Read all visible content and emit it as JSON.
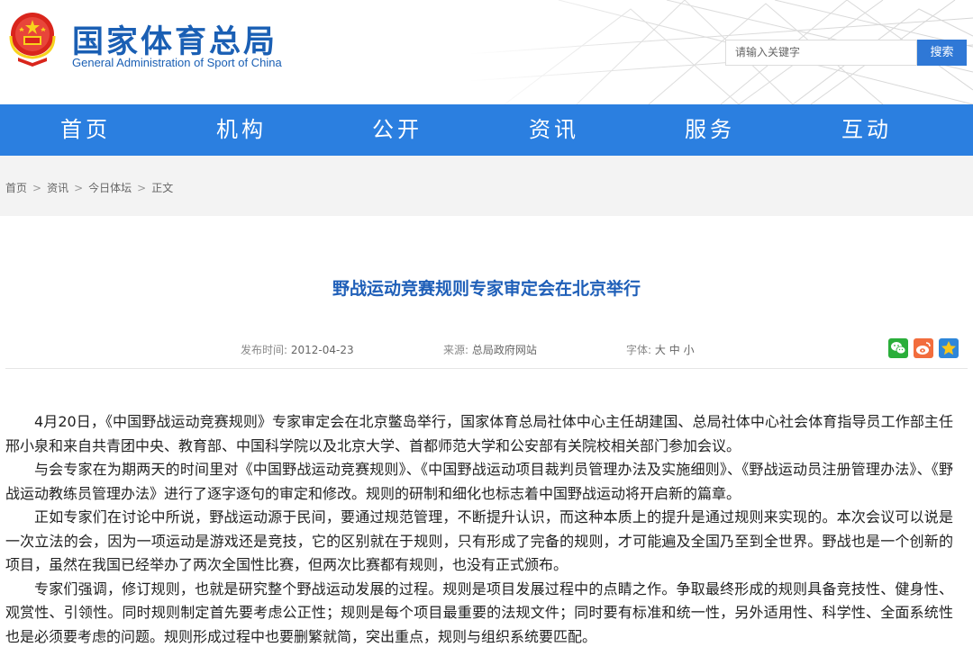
{
  "header": {
    "title": "国家体育总局",
    "subtitle": "General Administration of Sport of China",
    "search_placeholder": "请输入关键字",
    "search_button": "搜索"
  },
  "nav": {
    "items": [
      {
        "label": "首页"
      },
      {
        "label": "机构"
      },
      {
        "label": "公开"
      },
      {
        "label": "资讯"
      },
      {
        "label": "服务"
      },
      {
        "label": "互动"
      }
    ]
  },
  "breadcrumb": {
    "items": [
      "首页",
      "资讯",
      "今日体坛",
      "正文"
    ],
    "separator": ">"
  },
  "article": {
    "title": "野战运动竞赛规则专家审定会在北京举行",
    "date_label": "发布时间:",
    "date_value": "2012-04-23",
    "source_label": "来源:",
    "source_value": "总局政府网站",
    "font_label": "字体:",
    "font_large": "大",
    "font_medium": "中",
    "font_small": "小",
    "share_icons": [
      "wechat-icon",
      "weibo-icon",
      "favorite-icon"
    ],
    "paragraphs": [
      "4月20日，《中国野战运动竞赛规则》专家审定会在北京鳖岛举行，国家体育总局社体中心主任胡建国、总局社体中心社会体育指导员工作部主任邢小泉和来自共青团中央、教育部、中国科学院以及北京大学、首都师范大学和公安部有关院校相关部门参加会议。",
      "与会专家在为期两天的时间里对《中国野战运动竞赛规则》、《中国野战运动项目裁判员管理办法及实施细则》、《野战运动员注册管理办法》、《野战运动教练员管理办法》进行了逐字逐句的审定和修改。规则的研制和细化也标志着中国野战运动将开启新的篇章。",
      "正如专家们在讨论中所说，野战运动源于民间，要通过规范管理，不断提升认识，而这种本质上的提升是通过规则来实现的。本次会议可以说是一次立法的会，因为一项运动是游戏还是竞技，它的区别就在于规则，只有形成了完备的规则，才可能遍及全国乃至到全世界。野战也是一个创新的项目，虽然在我国已经举办了两次全国性比赛，但两次比赛都有规则，也没有正式颁布。",
      "专家们强调，修订规则，也就是研究整个野战运动发展的过程。规则是项目发展过程中的点睛之作。争取最终形成的规则具备竞技性、健身性、观赏性、引领性。同时规则制定首先要考虑公正性；规则是每个项目最重要的法规文件；同时要有标准和统一性，另外适用性、科学性、全面系统性也是必须要考虑的问题。规则形成过程中也要删繁就简，突出重点，规则与组织系统要匹配。"
    ]
  },
  "colors": {
    "brand_blue": "#1a5fb4",
    "nav_blue": "#2b7fe0",
    "title_blue": "#1f5fb8",
    "wechat_green": "#2aae3a",
    "weibo_orange": "#f26d3d",
    "favorite_blue": "#2d86d9"
  }
}
